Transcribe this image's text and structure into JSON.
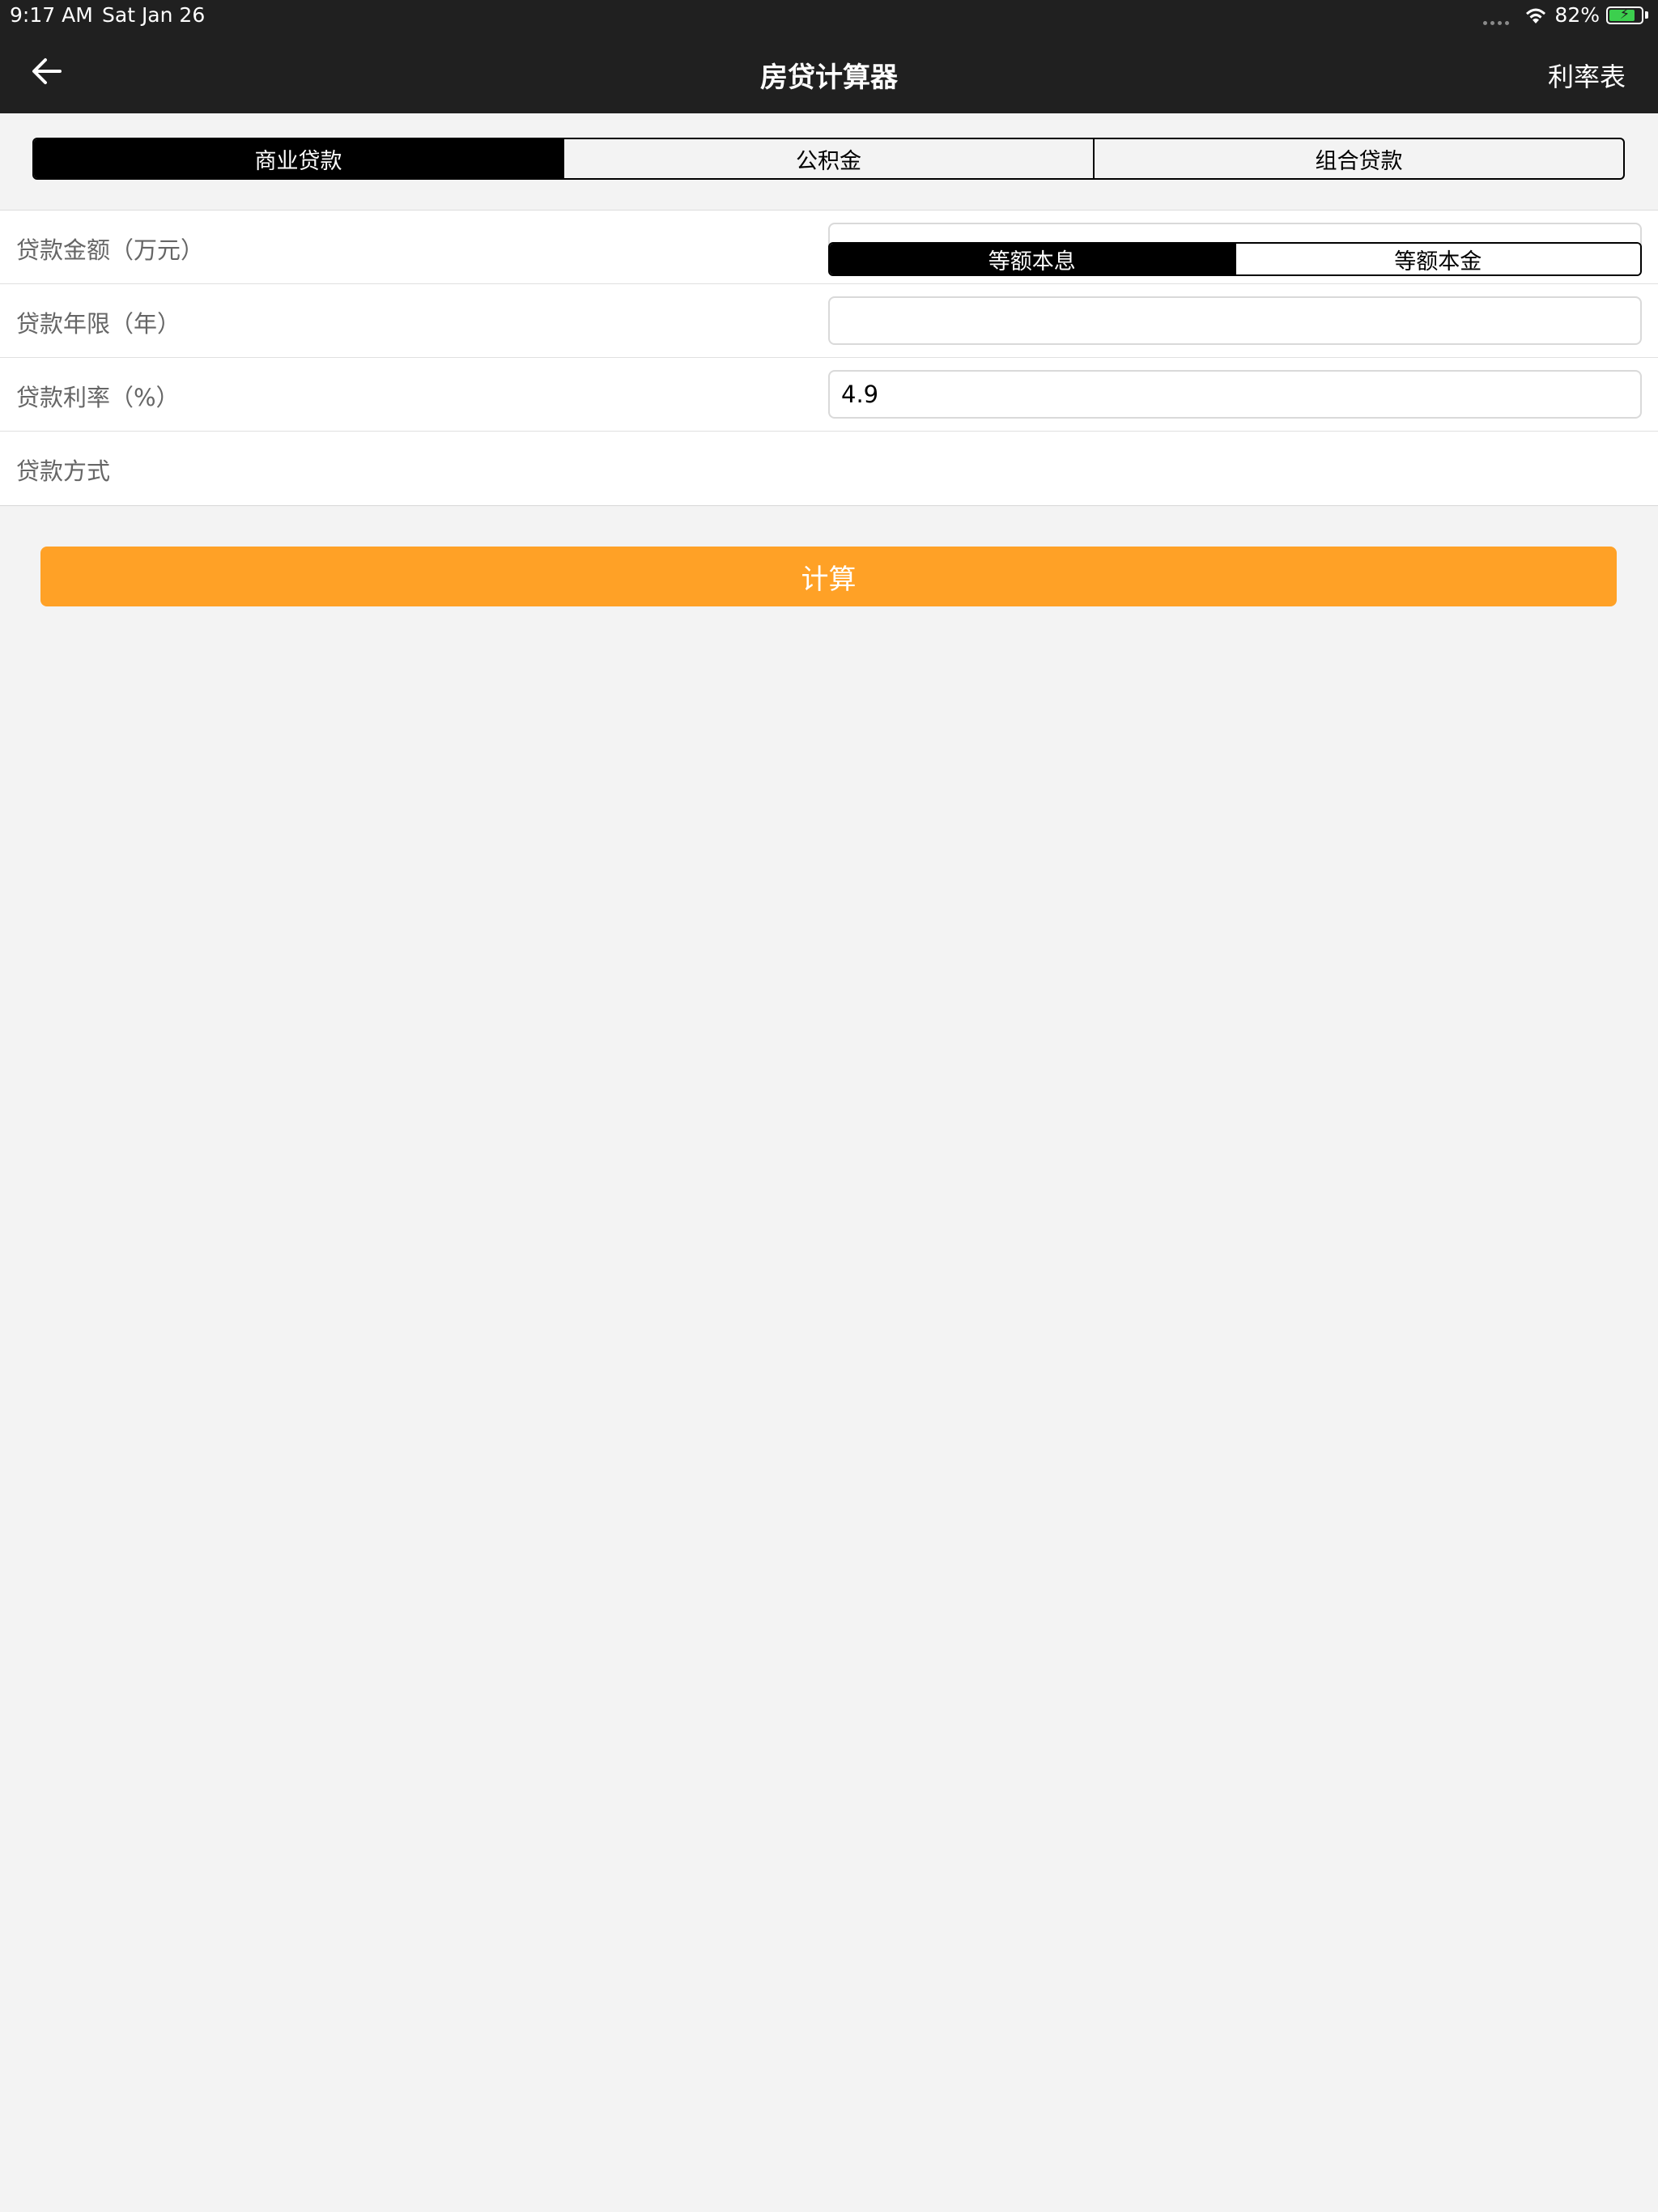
{
  "status_bar": {
    "time": "9:17 AM",
    "date": "Sat Jan 26",
    "battery": "82%",
    "battery_level": 0.82,
    "battery_color": "#3ccf4e",
    "wifi_icon": "wifi-icon",
    "battery_icon": "battery-charging-icon"
  },
  "nav": {
    "back_icon": "arrow-left-icon",
    "title": "房贷计算器",
    "rate_table": "利率表"
  },
  "loan_types": {
    "items": [
      "商业贷款",
      "公积金",
      "组合贷款"
    ],
    "selected": "商业贷款"
  },
  "form": {
    "amount": {
      "label": "贷款金额（万元）",
      "value": ""
    },
    "years": {
      "label": "贷款年限（年）",
      "value": ""
    },
    "rate": {
      "label": "贷款利率（%）",
      "value": "4.9"
    },
    "method": {
      "label": "贷款方式",
      "options": [
        "等额本息",
        "等额本金"
      ],
      "selected": "等额本息"
    }
  },
  "calculate_button": "计算",
  "colors": {
    "nav_bg": "#202020",
    "accent": "#ffa126",
    "page_bg": "#f3f3f3"
  }
}
